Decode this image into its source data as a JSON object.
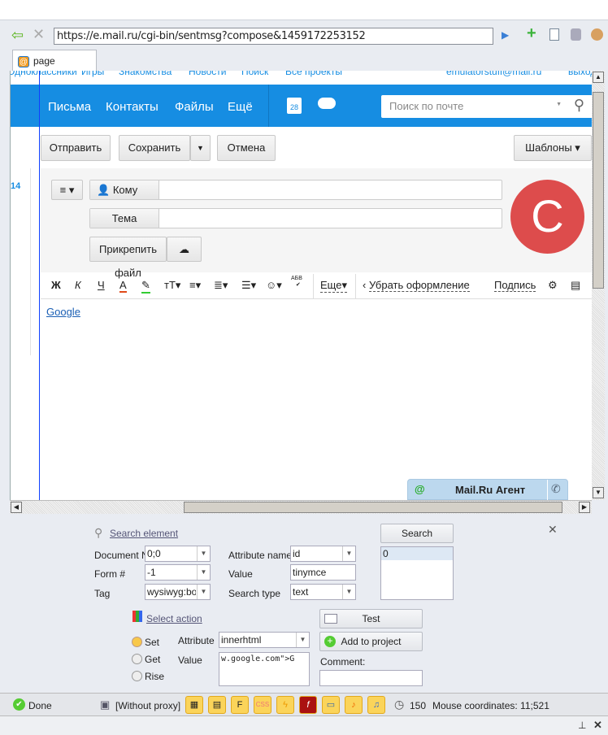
{
  "browser": {
    "url": "https://e.mail.ru/cgi-bin/sentmsg?compose&1459172253152",
    "tab_label": "page"
  },
  "mail": {
    "top_links": [
      "Одноклассники",
      "Игры",
      "Знакомства",
      "Новости",
      "Поиск",
      "Все проекты"
    ],
    "user_email": "emulatorstuff@mail.ru",
    "logout": "выход",
    "nav": [
      "Письма",
      "Контакты",
      "Файлы",
      "Ещё"
    ],
    "calendar_day": "28",
    "search_placeholder": "Поиск по почте",
    "sidebar_count": "14",
    "toolbar": {
      "send": "Отправить",
      "save": "Сохранить",
      "cancel": "Отмена",
      "templates": "Шаблоны"
    },
    "to_label": "Кому",
    "subject_label": "Тема",
    "attach": "Прикрепить файл",
    "avatar_letter": "C",
    "editor": {
      "bold": "Ж",
      "italic": "К",
      "underline": "Ч",
      "color": "А",
      "size": "тТ",
      "spell": "АБВ",
      "more": "Еще",
      "remove_format": "Убрать оформление",
      "signature": "Подпись"
    },
    "body_link": "Google",
    "agent": "Mail.Ru Агент"
  },
  "panel": {
    "search_element": "Search element",
    "search_button": "Search",
    "document_label": "Document N",
    "document_value": "0;0",
    "form_label": "Form #",
    "form_value": "-1",
    "tag_label": "Tag",
    "tag_value": "wysiwyg:body",
    "attr_name_label": "Attribute name",
    "attr_name_value": "id",
    "value_label": "Value",
    "value_value": "tinymce",
    "search_type_label": "Search type",
    "search_type_value": "text",
    "results": [
      "0"
    ],
    "select_action": "Select action",
    "test_button": "Test",
    "add_button": "Add to project",
    "radios": [
      {
        "label": "Set",
        "selected": true
      },
      {
        "label": "Get",
        "selected": false
      },
      {
        "label": "Rise",
        "selected": false
      }
    ],
    "attribute_label": "Attribute",
    "attribute_value": "innerhtml",
    "action_value_label": "Value",
    "action_value": "w.google.com\">G",
    "comment_label": "Comment:",
    "comment_value": ""
  },
  "status": {
    "state": "Done",
    "proxy": "[Without proxy]",
    "timer": "150",
    "mouse": "Mouse coordinates: 11;521"
  }
}
